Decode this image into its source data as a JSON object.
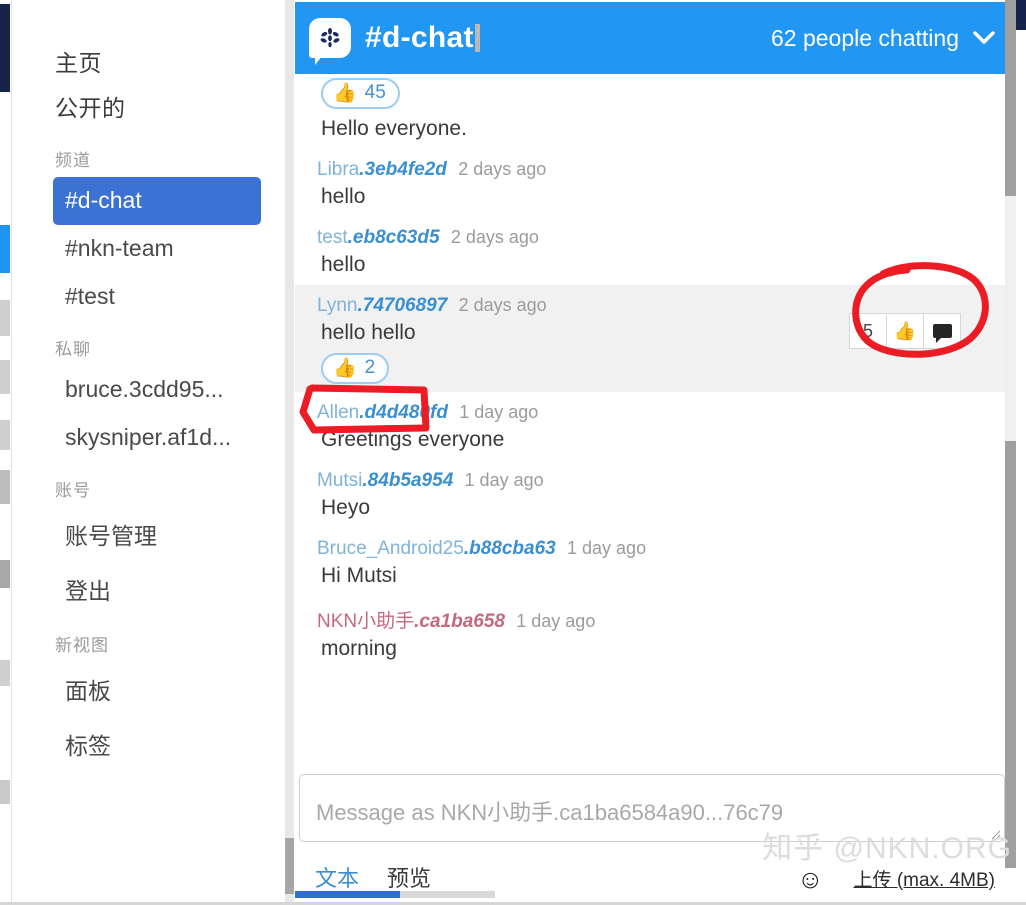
{
  "app": {
    "accent_blue": "#2196f3",
    "selected_channel_blue": "#3b72d4",
    "annotation_red": "#ec1c24",
    "watermark": "知乎 @NKN.ORG"
  },
  "sidebar": {
    "primary": [
      {
        "label": "主页",
        "name": "sidebar-item-home"
      },
      {
        "label": "公开的",
        "name": "sidebar-item-public"
      }
    ],
    "groups": [
      {
        "label": "频道",
        "items": [
          {
            "label": "#d-chat",
            "selected": true
          },
          {
            "label": "#nkn-team",
            "selected": false
          },
          {
            "label": "#test",
            "selected": false
          }
        ]
      },
      {
        "label": "私聊",
        "items": [
          {
            "label": "bruce.3cdd95...",
            "selected": false
          },
          {
            "label": "skysniper.af1d...",
            "selected": false
          }
        ]
      },
      {
        "label": "账号",
        "items": [
          {
            "label": "账号管理",
            "selected": false
          },
          {
            "label": "登出",
            "selected": false
          }
        ]
      },
      {
        "label": "新视图",
        "items": [
          {
            "label": "面板",
            "selected": false
          },
          {
            "label": "标签",
            "selected": false
          }
        ]
      }
    ]
  },
  "header": {
    "logo_icon": "nkn-speech-bubble-logo",
    "channel": "#d-chat",
    "people_text": "62 people chatting",
    "caret_icon": "chevron-down-icon"
  },
  "messages": [
    {
      "author": "",
      "hash": "",
      "time": "",
      "text": "Hello everyone.",
      "reaction": {
        "emoji": "👍",
        "count": "45"
      },
      "reaction_above": true,
      "self": false,
      "highlight": false
    },
    {
      "author": "Libra",
      "hash": ".3eb4fe2d",
      "time": "2 days ago",
      "text": "hello",
      "self": false,
      "highlight": false
    },
    {
      "author": "test",
      "hash": ".eb8c63d5",
      "time": "2 days ago",
      "text": "hello",
      "self": false,
      "highlight": false
    },
    {
      "author": "Lynn",
      "hash": ".74706897",
      "time": "2 days ago",
      "text": "hello hello",
      "reaction": {
        "emoji": "👍",
        "count": "2"
      },
      "self": false,
      "highlight": true
    },
    {
      "author": "Allen",
      "hash": ".d4d480fd",
      "time": "1 day ago",
      "text": "Greetings everyone",
      "self": false,
      "highlight": false
    },
    {
      "author": "Mutsi",
      "hash": ".84b5a954",
      "time": "1 day ago",
      "text": "Heyo",
      "self": false,
      "highlight": false
    },
    {
      "author": "Bruce_Android25",
      "hash": ".b88cba63",
      "time": "1 day ago",
      "text": "Hi Mutsi",
      "self": false,
      "highlight": false
    },
    {
      "author": "NKN小助手",
      "hash": ".ca1ba658",
      "time": "1 day ago",
      "text": "morning",
      "self": true,
      "highlight": false
    }
  ],
  "hover_tools": {
    "count_label": "5",
    "thumb_icon": "thumbs-up-icon",
    "reply_icon": "speech-bubble-icon"
  },
  "composer": {
    "placeholder": "Message as NKN小助手.ca1ba6584a90...76c79",
    "value": "",
    "tabs": [
      {
        "label": "文本",
        "active": true
      },
      {
        "label": "预览",
        "active": false
      }
    ],
    "emoji_icon": "smiley-face-icon",
    "upload_label": "上传 (max. 4MB)"
  }
}
